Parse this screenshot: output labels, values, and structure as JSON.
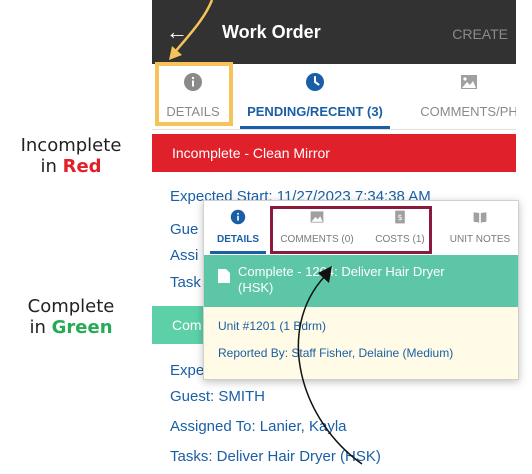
{
  "annotations": {
    "incomplete": {
      "word": "Incomplete",
      "prefix": "in",
      "color_word": "Red",
      "color": "#e0202a"
    },
    "complete": {
      "word": "Complete",
      "prefix": "in",
      "color_word": "Green",
      "color": "#27a955"
    }
  },
  "appbar": {
    "back_icon": "arrow-left-icon",
    "title": "Work Order",
    "action": "CREATE"
  },
  "tabs": [
    {
      "label": "DETAILS",
      "icon": "info-icon"
    },
    {
      "label": "PENDING/RECENT (3)",
      "icon": "clock-icon"
    },
    {
      "label": "COMMENTS/PH",
      "icon": "image-icon"
    }
  ],
  "incomplete_item": {
    "banner": "Incomplete - Clean Mirror",
    "expected_start": "Expected Start: 11/27/2023 7:34:38 AM",
    "guest_partial": "Gue",
    "assigned_partial": "Assi",
    "tasks_partial": "Task"
  },
  "complete_item": {
    "banner_partial": "Com",
    "expected_partial": "Expe",
    "guest": "Guest: SMITH",
    "assigned": "Assigned To: Lanier, Kayla",
    "tasks": "Tasks: Deliver Hair Dryer (HSK)"
  },
  "popup": {
    "tabs": [
      {
        "label": "DETAILS",
        "icon": "info-icon"
      },
      {
        "label": "COMMENTS (0)",
        "icon": "image-icon"
      },
      {
        "label": "COSTS (1)",
        "icon": "dollar-document-icon"
      },
      {
        "label": "UNIT NOTES",
        "icon": "book-icon"
      }
    ],
    "header_line1": "Complete - 12",
    "header_line1_tail": "04: Deliver Hair Dryer",
    "header_line2": "(HSK)",
    "unit": "Unit #1201 (1 Bdrm)",
    "reported_by": "Reported By: Staff Fisher, Delaine (Medium)"
  }
}
